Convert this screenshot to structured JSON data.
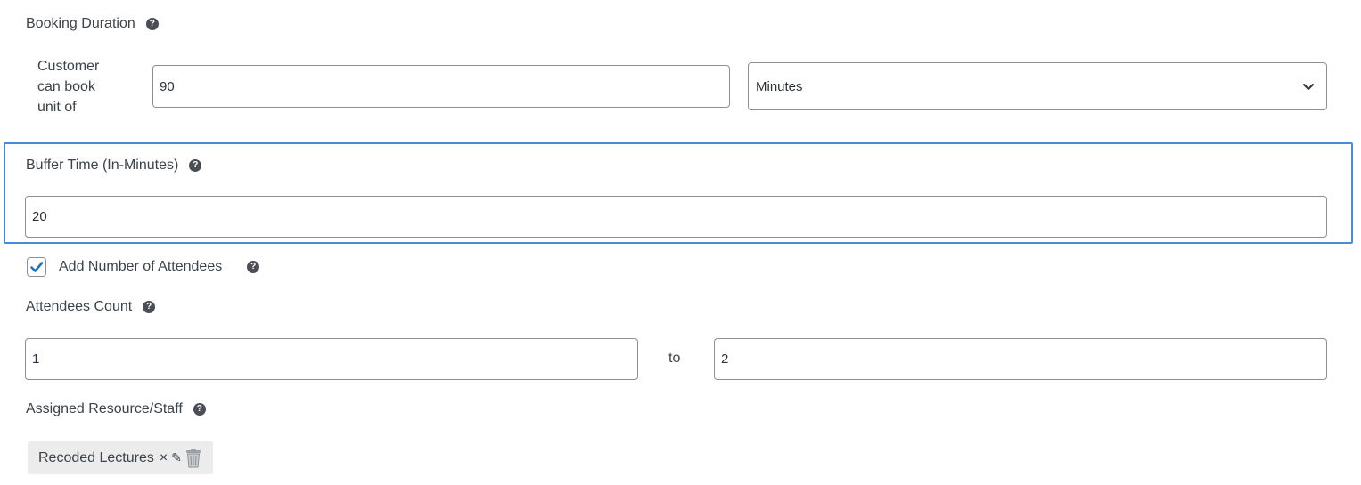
{
  "booking_duration": {
    "label": "Booking Duration",
    "help_icon": "question-circle-icon",
    "unit_label_lines": [
      "Customer",
      "can book",
      "unit of"
    ],
    "value": "90",
    "unit_select": {
      "selected": "Minutes",
      "icon": "chevron-down-icon"
    }
  },
  "buffer_time": {
    "label": "Buffer Time (In-Minutes)",
    "help_icon": "question-circle-icon",
    "value": "20"
  },
  "add_attendees": {
    "label": "Add Number of Attendees",
    "checked": true,
    "help_icon": "question-circle-icon"
  },
  "attendees_count": {
    "label": "Attendees Count",
    "help_icon": "question-circle-icon",
    "min": "1",
    "separator": "to",
    "max": "2"
  },
  "assigned_resource": {
    "label": "Assigned Resource/Staff",
    "help_icon": "question-circle-icon",
    "chips": [
      {
        "label": "Recoded Lectures",
        "remove_symbol": "×",
        "edit_symbol": "✎",
        "remove_icon": "close-icon",
        "edit_icon": "pencil-icon",
        "delete_icon": "trash-icon"
      }
    ]
  },
  "colors": {
    "focus_border": "#4a8bdc",
    "checkbox_check": "#2271b1",
    "input_border": "#8c8f94",
    "chip_background": "#ececec"
  }
}
